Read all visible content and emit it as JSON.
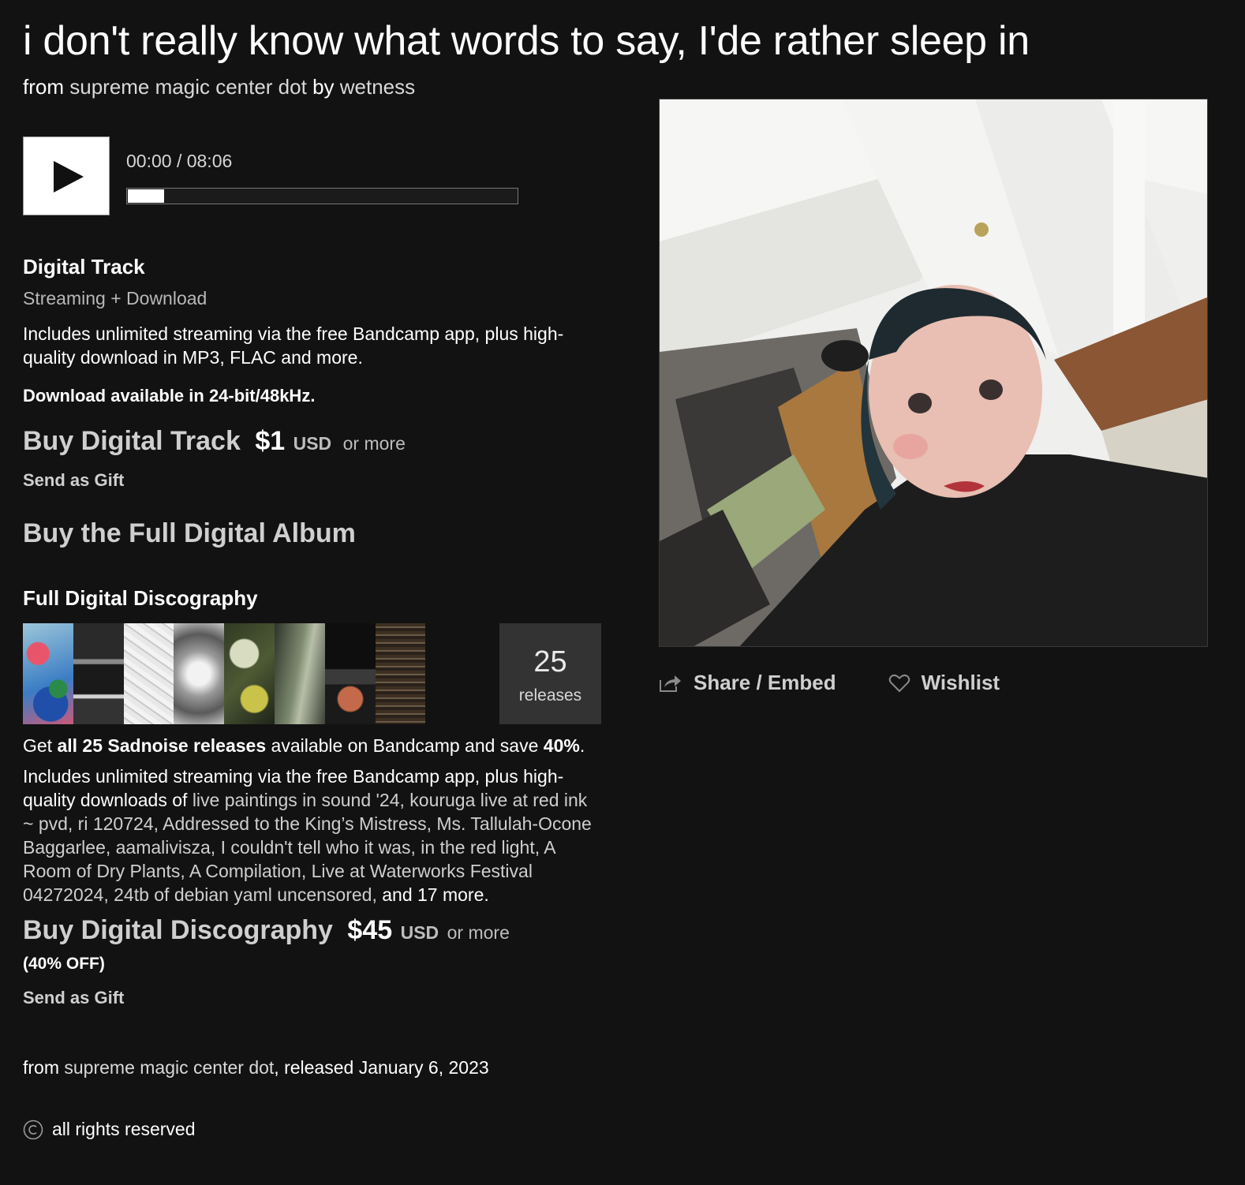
{
  "track": {
    "title": "i don't really know what words to say, I'de rather sleep in",
    "from_prefix": "from",
    "album_name": "supreme magic center dot",
    "by_prefix": "by",
    "artist": "wetness"
  },
  "player": {
    "time": "00:00 / 08:06",
    "progress_percent": 0,
    "play_icon": "play-icon"
  },
  "digital_track": {
    "heading": "Digital Track",
    "subheading": "Streaming + Download",
    "description": "Includes unlimited streaming via the free Bandcamp app, plus high-quality download in MP3, FLAC and more.",
    "note": "Download available in 24-bit/48kHz.",
    "buy_label": "Buy Digital Track",
    "price": "$1",
    "currency": "USD",
    "or_more": "or more",
    "gift_label": "Send as Gift"
  },
  "full_album": {
    "label": "Buy the Full Digital Album"
  },
  "discography": {
    "heading": "Full Digital Discography",
    "releases_count": "25",
    "releases_label": "releases",
    "get_prefix": "Get",
    "get_bold": "all 25 Sadnoise releases",
    "get_middle": "available on Bandcamp and save",
    "get_discount": "40%",
    "get_end": ".",
    "desc_prefix": "Includes unlimited streaming via the free Bandcamp app, plus high-quality downloads of",
    "desc_items": "live paintings in sound '24, kouruga live at red ink ~ pvd, ri 120724, Addressed to the King’s Mistress, Ms. Tallulah-Ocone Baggarlee, aamalivisza, I couldn't tell who it was, in the red light, A Room of Dry Plants, A Compilation, Live at Waterworks Festival 04272024, 24tb of debian yaml uncensored,",
    "desc_suffix": "and 17 more.",
    "buy_label": "Buy Digital Discography",
    "price": "$45",
    "currency": "USD",
    "or_more": "or more",
    "discount_label": "(40% OFF)",
    "gift_label": "Send as Gift"
  },
  "release_info": {
    "from_prefix": "from",
    "album_name": "supreme magic center dot",
    "released_text": ", released January 6, 2023"
  },
  "rights": {
    "text": "all rights reserved",
    "icon": "copyright-icon"
  },
  "actions": {
    "share_label": "Share / Embed",
    "share_icon": "share-icon",
    "wishlist_label": "Wishlist",
    "wishlist_icon": "heart-icon"
  }
}
